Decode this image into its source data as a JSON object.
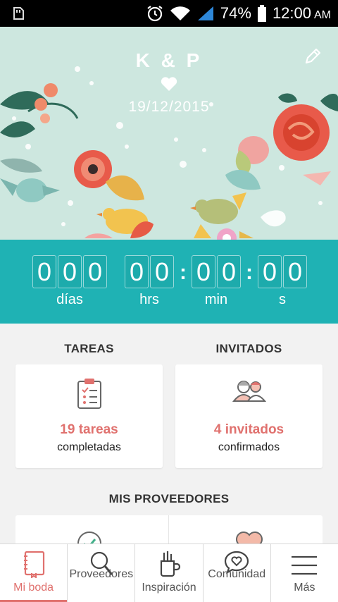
{
  "status_bar": {
    "battery": "74%",
    "time": "12:00",
    "ampm": "AM"
  },
  "header": {
    "couple": "K & P",
    "date": "19/12/2015"
  },
  "countdown": {
    "days_digits": [
      "0",
      "0",
      "0"
    ],
    "hours_digits": [
      "0",
      "0"
    ],
    "minutes_digits": [
      "0",
      "0"
    ],
    "seconds_digits": [
      "0",
      "0"
    ],
    "separator": ":",
    "labels": {
      "days": "días",
      "hours": "hrs",
      "minutes": "min",
      "seconds": "s"
    }
  },
  "sections": {
    "tasks": {
      "title": "TAREAS",
      "count": "19 tareas",
      "status": "completadas",
      "icon": "clipboard-checklist-icon"
    },
    "guests": {
      "title": "INVITADOS",
      "count": "4 invitados",
      "status": "confirmados",
      "icon": "couple-people-icon"
    },
    "vendors": {
      "title": "MIS PROVEEDORES"
    }
  },
  "bottom_nav": [
    {
      "label": "Mi boda",
      "icon": "wedding-book-icon",
      "active": true
    },
    {
      "label": "Proveedores",
      "icon": "search-icon",
      "active": false
    },
    {
      "label": "Inspiración",
      "icon": "brushes-cup-icon",
      "active": false
    },
    {
      "label": "Comunidad",
      "icon": "heart-chat-icon",
      "active": false
    },
    {
      "label": "Más",
      "icon": "menu-icon",
      "active": false
    }
  ],
  "colors": {
    "accent": "#e0716e",
    "teal": "#1fb2b4",
    "hero_bg": "#cde7df"
  }
}
